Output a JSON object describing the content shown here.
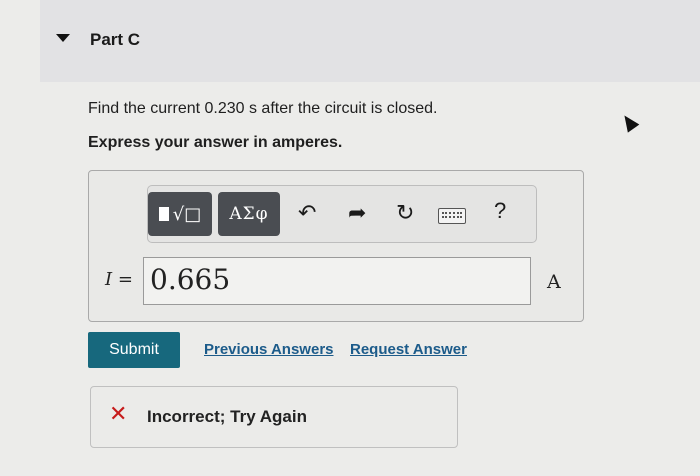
{
  "part": {
    "title": "Part C"
  },
  "question": {
    "text": "Find the current 0.230 s after the circuit is closed.",
    "instruction": "Express your answer in amperes."
  },
  "toolbar": {
    "templates_label": "√□",
    "greek_label": "ΑΣφ",
    "undo_glyph": "↶",
    "redo_glyph": "➦",
    "reset_glyph": "↻",
    "help_label": "?"
  },
  "answer": {
    "variable": "I",
    "equals": "=",
    "value": "0.665",
    "unit": "A"
  },
  "actions": {
    "submit_label": "Submit",
    "previous_answers_label": "Previous Answers",
    "request_answer_label": "Request Answer"
  },
  "feedback": {
    "icon": "✕",
    "text": "Incorrect; Try Again",
    "color": "#c61b1b"
  },
  "colors": {
    "submit_bg": "#17687d",
    "link": "#1c5b8a"
  }
}
